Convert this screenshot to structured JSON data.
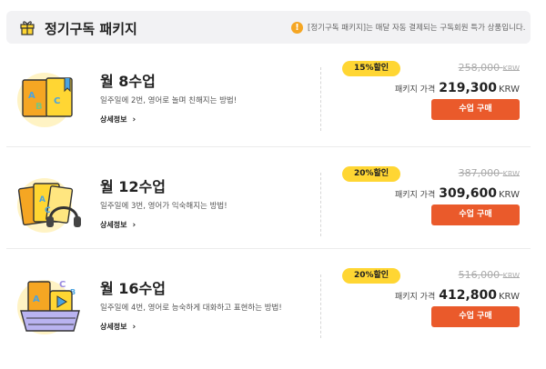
{
  "header": {
    "title": "정기구독 패키지",
    "notice_icon": "!",
    "notice": "[정기구독 패키지]는 매달 자동 결제되는 구독회원 특가 상품입니다."
  },
  "packages": [
    {
      "name": "월 8수업",
      "description": "일주일에 2번, 영어로 놀며 친해지는 방법!",
      "detail_label": "상세정보",
      "discount": "15%할인",
      "original_price": "258,000",
      "original_unit": "KRW",
      "price_label": "패키지 가격",
      "price": "219,300",
      "price_unit": "KRW",
      "buy_label": "수업 구매"
    },
    {
      "name": "월 12수업",
      "description": "일주일에 3번, 영어가 익숙해지는 방법!",
      "detail_label": "상세정보",
      "discount": "20%할인",
      "original_price": "387,000",
      "original_unit": "KRW",
      "price_label": "패키지 가격",
      "price": "309,600",
      "price_unit": "KRW",
      "buy_label": "수업 구매"
    },
    {
      "name": "월 16수업",
      "description": "일주일에 4번, 영어로 능숙하게 대화하고 표현하는 방법!",
      "detail_label": "상세정보",
      "discount": "20%할인",
      "original_price": "516,000",
      "original_unit": "KRW",
      "price_label": "패키지 가격",
      "price": "412,800",
      "price_unit": "KRW",
      "buy_label": "수업 구매"
    }
  ],
  "colors": {
    "accent": "#ea5a2b",
    "badge": "#ffd633",
    "header_bg": "#f2f2f4",
    "illus_bg": "#fff3c4"
  }
}
